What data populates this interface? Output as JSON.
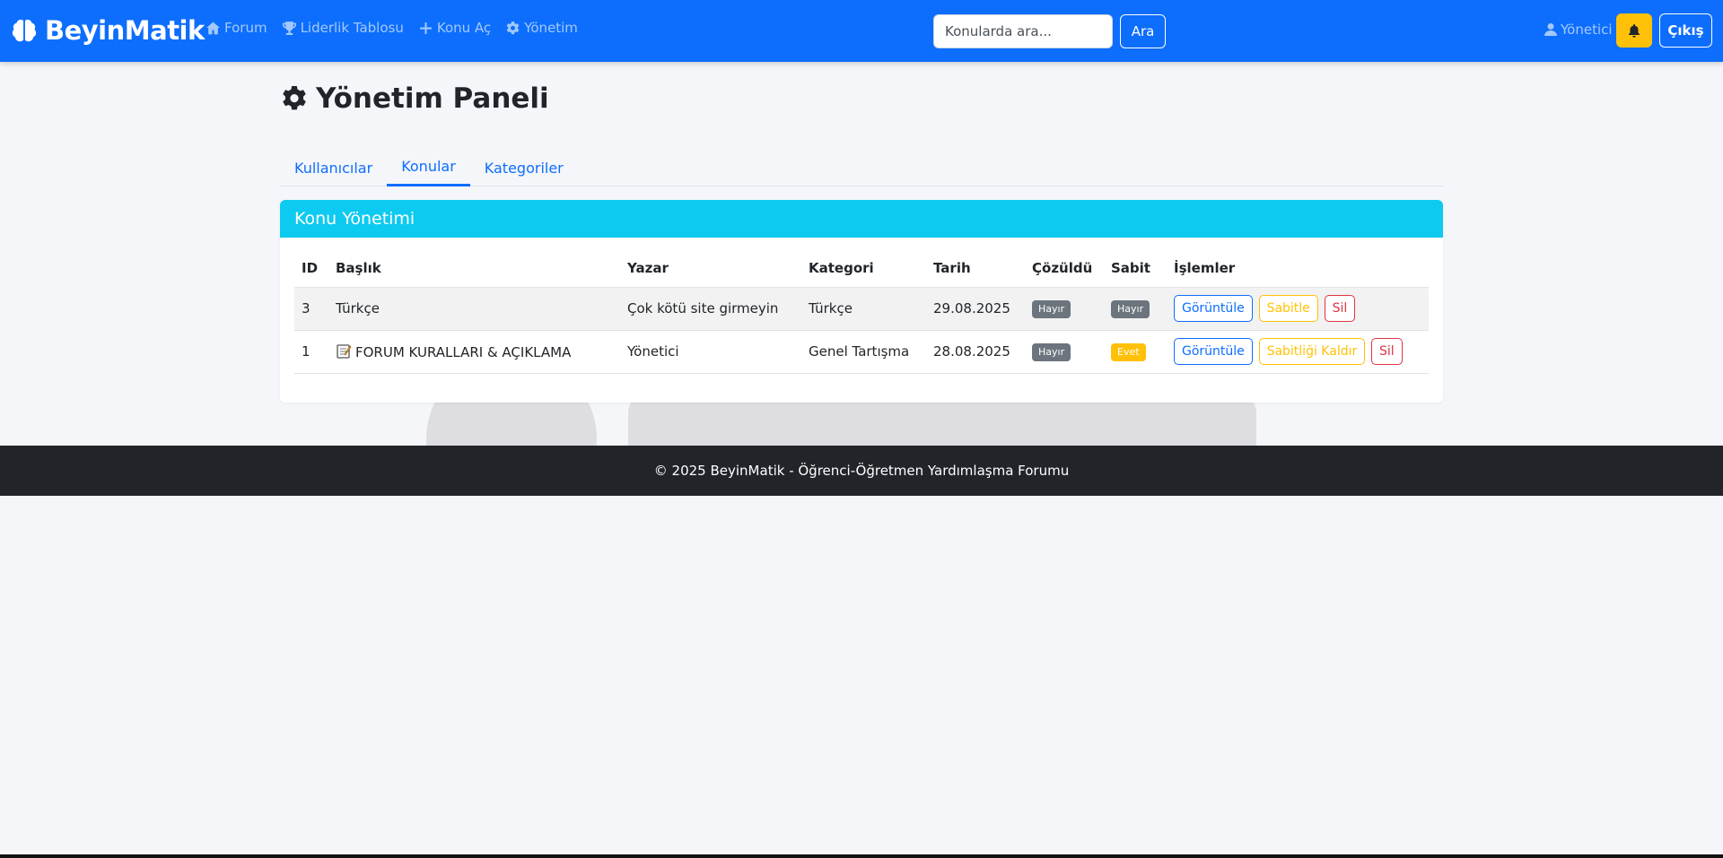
{
  "navbar": {
    "brand": "BeyinMatik",
    "links": [
      {
        "label": "Forum",
        "icon": "home-icon"
      },
      {
        "label": "Liderlik Tablosu",
        "icon": "trophy-icon"
      },
      {
        "label": "Konu Aç",
        "icon": "plus-icon"
      },
      {
        "label": "Yönetim",
        "icon": "gear-icon"
      }
    ],
    "search_placeholder": "Konularda ara...",
    "search_button": "Ara",
    "user_label": "Yönetici",
    "logout_label": "Çıkış"
  },
  "page": {
    "title": "Yönetim Paneli",
    "tabs": [
      "Kullanıcılar",
      "Konular",
      "Kategoriler"
    ],
    "active_tab": "Konular"
  },
  "card": {
    "header": "Konu Yönetimi",
    "columns": [
      "ID",
      "Başlık",
      "Yazar",
      "Kategori",
      "Tarih",
      "Çözüldü",
      "Sabit",
      "İşlemler"
    ],
    "rows": [
      {
        "id": "3",
        "title": "Türkçe",
        "author": "Çok kötü site girmeyin",
        "category": "Türkçe",
        "date": "29.08.2025",
        "solved": "Hayır",
        "pinned": "Hayır",
        "actions": [
          "Görüntüle",
          "Sabitle",
          "Sil"
        ]
      },
      {
        "id": "1",
        "title": "FORUM KURALLARI & AÇIKLAMA",
        "author": "Yönetici",
        "category": "Genel Tartışma",
        "date": "28.08.2025",
        "solved": "Hayır",
        "pinned": "Evet",
        "actions": [
          "Görüntüle",
          "Sabitliği Kaldır",
          "Sil"
        ]
      }
    ]
  },
  "footer": {
    "text": "© 2025 BeyinMatik - Öğrenci-Öğretmen Yardımlaşma Forumu"
  },
  "colors": {
    "primary": "#0d6efd",
    "info": "#0dcaf0",
    "warning": "#ffc107",
    "danger": "#dc3545",
    "secondary": "#6c757d",
    "dark": "#212529"
  }
}
